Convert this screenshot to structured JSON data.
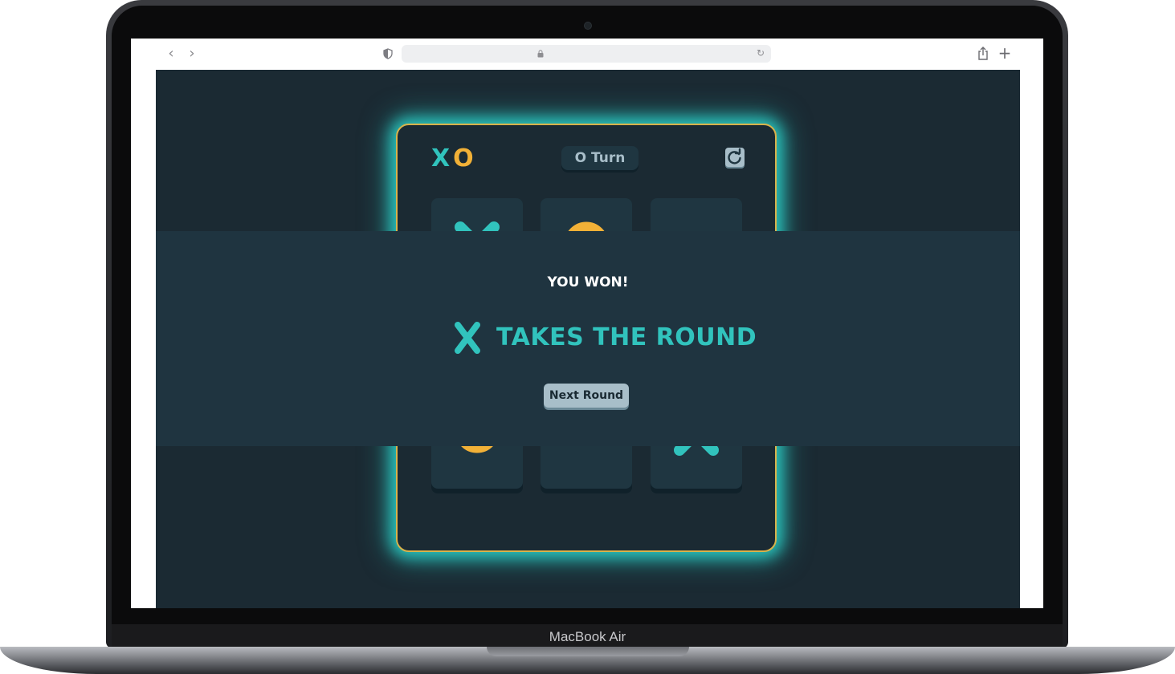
{
  "device": {
    "label": "MacBook Air"
  },
  "browser": {
    "back_icon": "chevron-left-icon",
    "forward_icon": "chevron-right-icon",
    "address": ""
  },
  "game": {
    "logo": {
      "x": "X",
      "o": "O"
    },
    "turn_label": "O Turn",
    "board": [
      [
        "X",
        "O",
        ""
      ],
      [
        "",
        "",
        ""
      ],
      [
        "O",
        "",
        "X"
      ]
    ],
    "result": {
      "title": "YOU WON!",
      "message": "TAKES THE ROUND",
      "winner": "X",
      "next_button": "Next Round"
    },
    "colors": {
      "x": "#31c3bd",
      "o": "#f2b137",
      "background": "#1b2a33",
      "tile": "#1f3641",
      "silver": "#a8bec9"
    }
  }
}
